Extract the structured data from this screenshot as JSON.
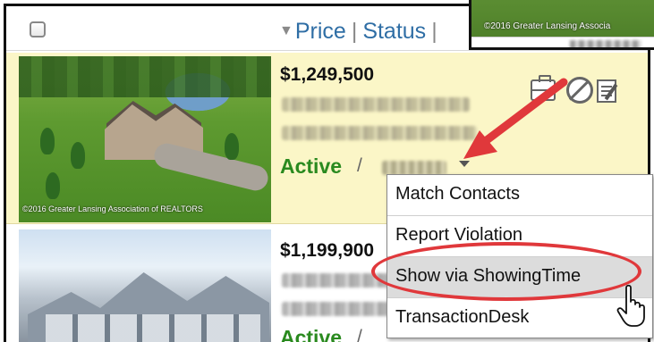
{
  "header": {
    "sort_caret": "▼",
    "sort_label": "Price",
    "separator": "|",
    "status_label": "Status",
    "separator2": "|"
  },
  "listings": [
    {
      "index": "6",
      "price": "$1,249,500",
      "status": "Active",
      "slash": "/",
      "photo_credit": "©2016 Greater Lansing Association of REALTORS"
    },
    {
      "index": "7",
      "price": "$1,199,900",
      "status": "Active",
      "slash": "/"
    }
  ],
  "inset": {
    "photo_credit": "©2016 Greater Lansing Associa"
  },
  "menu": {
    "items": [
      "Match Contacts",
      "Report Violation",
      "Show via ShowingTime",
      "TransactionDesk"
    ],
    "highlighted_index": 2
  },
  "colors": {
    "link": "#2f6ea5",
    "status_active": "#2a8a1f",
    "highlight_bg": "#fbf6c7",
    "annotation_red": "#e0383b"
  },
  "icons": [
    "briefcase-icon",
    "prohibit-icon",
    "notes-icon",
    "pointer-cursor-icon",
    "chevron-down-icon"
  ]
}
